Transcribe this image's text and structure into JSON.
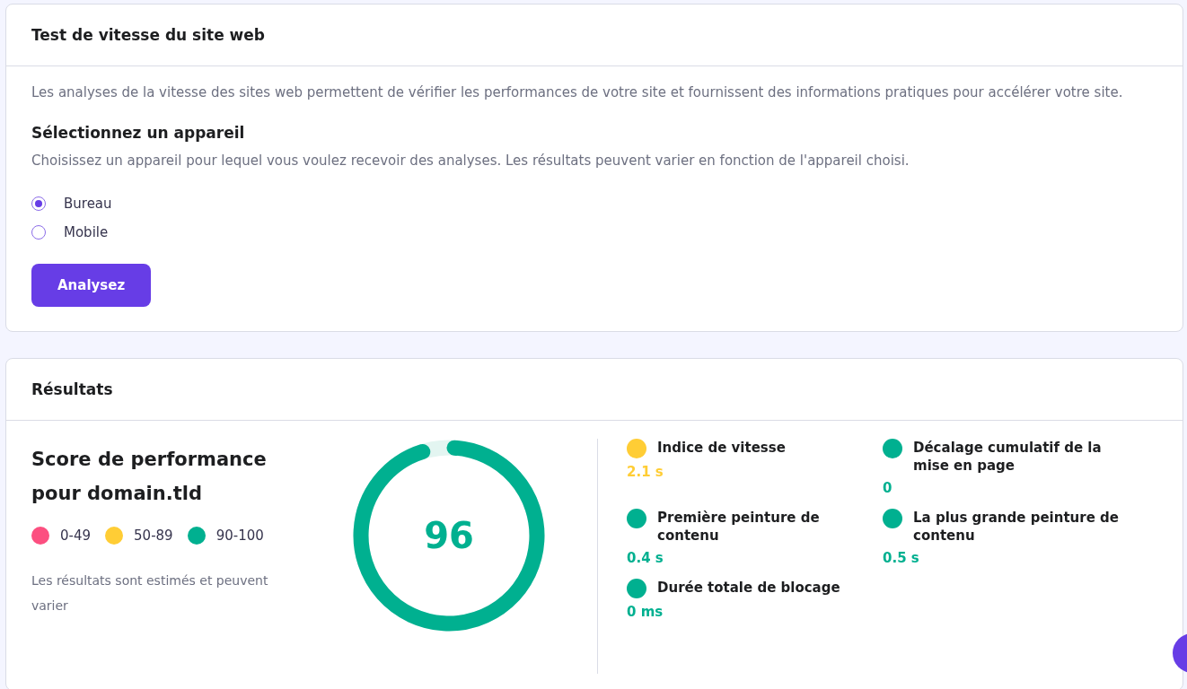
{
  "speed_test": {
    "title": "Test de vitesse du site web",
    "description": "Les analyses de la vitesse des sites web permettent de vérifier les performances de votre site et fournissent des informations pratiques pour accélérer votre site.",
    "device_heading": "Sélectionnez un appareil",
    "device_hint": "Choisissez un appareil pour lequel vous voulez recevoir des analyses. Les résultats peuvent varier en fonction de l'appareil choisi.",
    "devices": [
      {
        "label": "Bureau",
        "selected": true
      },
      {
        "label": "Mobile",
        "selected": false
      }
    ],
    "button": "Analysez"
  },
  "results": {
    "title": "Résultats",
    "score_title": "Score de performance pour domain.tld",
    "legend": [
      {
        "label": "0-49",
        "color": "#fc4f80"
      },
      {
        "label": "50-89",
        "color": "#ffcd35"
      },
      {
        "label": "90-100",
        "color": "#00b090"
      }
    ],
    "note": "Les résultats sont estimés et peuvent varier",
    "score": {
      "value": "96",
      "level": 0.96,
      "color": "#00b090"
    },
    "metrics": [
      {
        "name": "Indice de vitesse",
        "value": "2.1 s",
        "color": "#ffcd35"
      },
      {
        "name": "Décalage cumulatif de la mise en page",
        "value": "0",
        "color": "#00b090"
      },
      {
        "name": "Première peinture de contenu",
        "value": "0.4 s",
        "color": "#00b090"
      },
      {
        "name": "La plus grande peinture de contenu",
        "value": "0.5 s",
        "color": "#00b090"
      },
      {
        "name": "Durée totale de blocage",
        "value": "0 ms",
        "color": "#00b090"
      }
    ]
  }
}
